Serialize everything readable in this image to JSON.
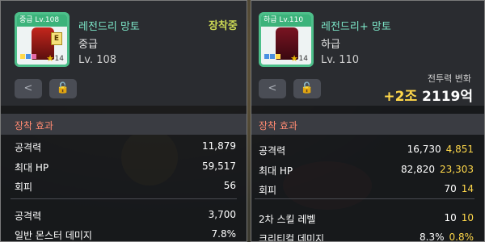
{
  "left": {
    "thumb_tag": "중급 Lv.108",
    "badge": "E",
    "star_level": "14",
    "item_name": "레전드리 망토",
    "grade": "중급",
    "level": "Lv. 108",
    "equipped": "장착중",
    "share_icon": "share-icon",
    "lock_icon": "unlock-icon",
    "section_title": "장착 효과",
    "stats": [
      {
        "label": "공격력",
        "value": "11,879"
      },
      {
        "label": "최대 HP",
        "value": "59,517"
      },
      {
        "label": "회피",
        "value": "56"
      },
      {
        "label": "공격력",
        "value": "3,700"
      },
      {
        "label": "일반 몬스터 데미지",
        "value": "7.8%"
      }
    ]
  },
  "right": {
    "thumb_tag": "하급 Lv.110",
    "star_level": "14",
    "item_name": "레전드리+ 망토",
    "grade": "하급",
    "level": "Lv. 110",
    "share_icon": "share-icon",
    "lock_icon": "unlock-icon",
    "power_label": "전투력 변화",
    "power_plus": "+2조",
    "power_value": "2119억",
    "section_title": "장착 효과",
    "stats": [
      {
        "label": "공격력",
        "value": "16,730",
        "diff": "4,851"
      },
      {
        "label": "최대 HP",
        "value": "82,820",
        "diff": "23,303"
      },
      {
        "label": "회피",
        "value": "70",
        "diff": "14"
      },
      {
        "label": "2차 스킬 레벨",
        "value": "10",
        "diff": "10"
      },
      {
        "label": "크리티컬 데미지",
        "value": "8.3%",
        "diff": "0.8%"
      }
    ]
  },
  "colors": {
    "accent_green": "#4dbf8a",
    "name_cyan": "#7de8c9",
    "equipped_yellow": "#cddb55",
    "section_red": "#ff8a72",
    "diff_yellow": "#ffd84a"
  }
}
